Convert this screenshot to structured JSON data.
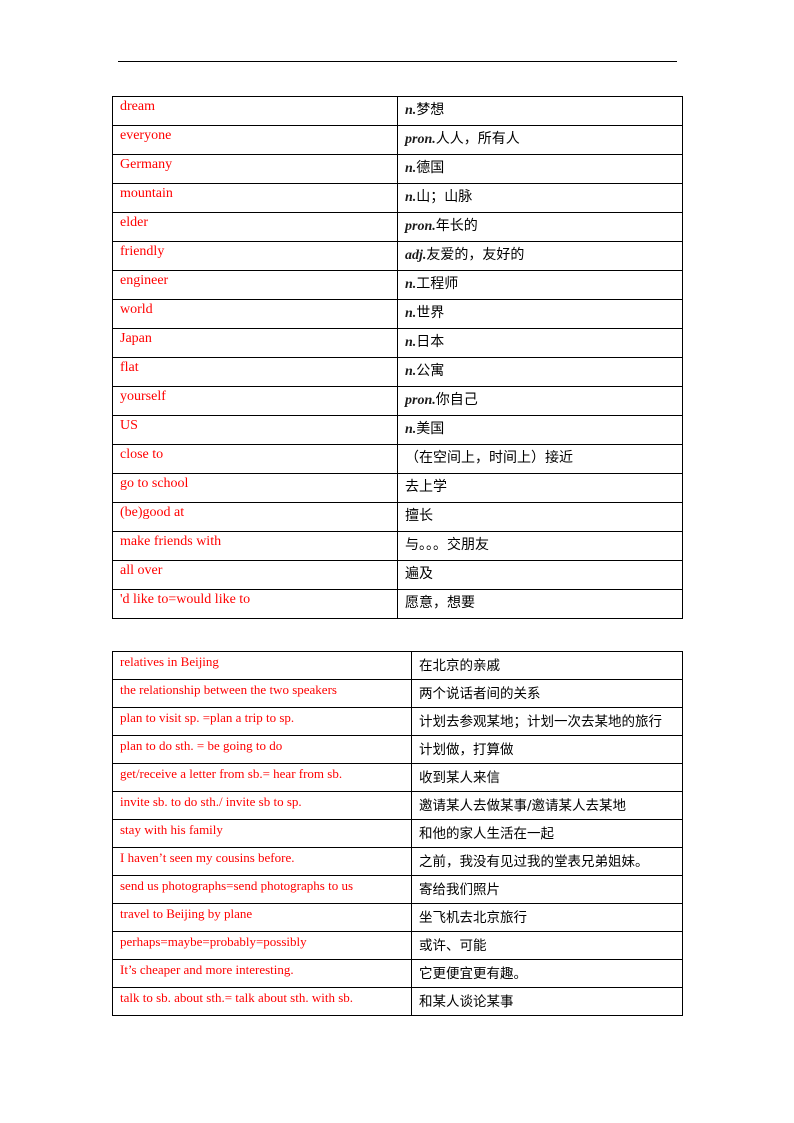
{
  "colors": {
    "english_text": "#ff0000",
    "chinese_text": "#000000",
    "border": "#000000"
  },
  "table1": {
    "rows": [
      {
        "en": "dream",
        "pos": "n.",
        "zh": "梦想"
      },
      {
        "en": "everyone",
        "pos": "pron.",
        "zh": "人人，所有人"
      },
      {
        "en": "Germany",
        "pos": "n.",
        "zh": "德国"
      },
      {
        "en": "mountain",
        "pos": "n.",
        "zh": "山；山脉"
      },
      {
        "en": "elder",
        "pos": "pron.",
        "zh": "年长的"
      },
      {
        "en": "friendly",
        "pos": "adj.",
        "zh": "友爱的，友好的"
      },
      {
        "en": "engineer",
        "pos": "n.",
        "zh": "工程师"
      },
      {
        "en": "world",
        "pos": "n.",
        "zh": "世界"
      },
      {
        "en": "Japan",
        "pos": "n.",
        "zh": "日本"
      },
      {
        "en": "flat",
        "pos": "n.",
        "zh": "公寓"
      },
      {
        "en": "yourself",
        "pos": "pron.",
        "zh": "你自己"
      },
      {
        "en": "US",
        "pos": "n.",
        "zh": "美国"
      },
      {
        "en": "close to",
        "pos": "",
        "zh": "（在空间上，时间上）接近"
      },
      {
        "en": "go to school",
        "pos": "",
        "zh": "去上学"
      },
      {
        "en": "(be)good at",
        "pos": "",
        "zh": "擅长"
      },
      {
        "en": "make friends with",
        "pos": "",
        "zh": "与。。。交朋友"
      },
      {
        "en": "all over",
        "pos": "",
        "zh": "遍及"
      },
      {
        "en": "'d like to=would like to",
        "pos": "",
        "zh": "愿意，想要"
      }
    ]
  },
  "table2": {
    "rows": [
      {
        "en": "relatives in Beijing",
        "zh": "在北京的亲戚"
      },
      {
        "en": "the relationship between the two speakers",
        "zh": "两个说话者间的关系"
      },
      {
        "en": "plan to visit sp. =plan a trip to sp.",
        "zh": "计划去参观某地；计划一次去某地的旅行"
      },
      {
        "en": "plan to do sth. = be going to do",
        "zh": "计划做，打算做"
      },
      {
        "en": "get/receive a letter from sb.= hear from sb.",
        "zh": "收到某人来信"
      },
      {
        "en": "invite sb. to do sth./ invite sb to sp.",
        "zh": "邀请某人去做某事/邀请某人去某地"
      },
      {
        "en": "stay with his family",
        "zh": "和他的家人生活在一起"
      },
      {
        "en": "I haven’t seen my cousins before.",
        "zh": "之前，我没有见过我的堂表兄弟姐妹。"
      },
      {
        "en": "send us photographs=send photographs to us",
        "zh": "寄给我们照片"
      },
      {
        "en": "travel to Beijing by plane",
        "zh": "坐飞机去北京旅行"
      },
      {
        "en": "perhaps=maybe=probably=possibly",
        "zh": "或许、可能"
      },
      {
        "en": "It’s cheaper and more interesting.",
        "zh": "它更便宜更有趣。"
      },
      {
        "en": "talk to sb. about sth.= talk about sth. with sb.",
        "zh": "和某人谈论某事"
      }
    ]
  }
}
